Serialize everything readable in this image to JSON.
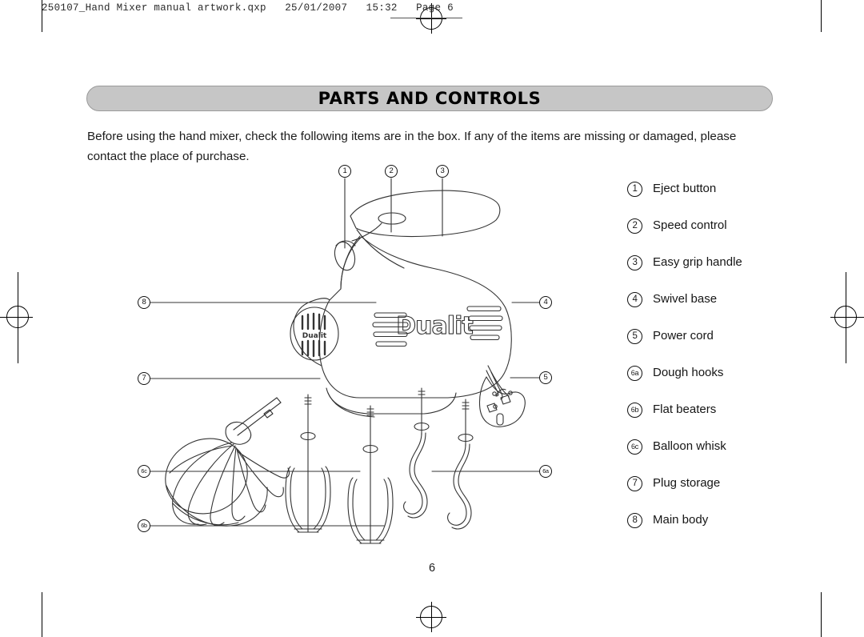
{
  "file_header": {
    "text": "250107_Hand Mixer manual artwork.qxp   25/01/2007   15:32   Page 6",
    "filename": "250107_Hand Mixer manual artwork.qxp",
    "date": "25/01/2007",
    "time": "15:32",
    "page_marker": "Page 6"
  },
  "banner": {
    "title": "PARTS AND CONTROLS"
  },
  "intro": {
    "line1": "Before using the hand mixer, check the following items are in the box. If any of the items are missing or damaged,",
    "line2": "please contact the place of purchase."
  },
  "legend": {
    "items": [
      {
        "number": "1",
        "label": "Eject button"
      },
      {
        "number": "2",
        "label": "Speed control"
      },
      {
        "number": "3",
        "label": "Easy grip handle"
      },
      {
        "number": "4",
        "label": "Swivel base"
      },
      {
        "number": "5",
        "label": "Power cord"
      },
      {
        "number": "6a",
        "label": "Dough hooks"
      },
      {
        "number": "6b",
        "label": "Flat beaters"
      },
      {
        "number": "6c",
        "label": "Balloon whisk"
      },
      {
        "number": "7",
        "label": "Plug storage"
      },
      {
        "number": "8",
        "label": "Main body"
      }
    ]
  },
  "diagram": {
    "brand_text": "Dualit",
    "callouts": [
      {
        "number": "1",
        "name": "eject-button"
      },
      {
        "number": "2",
        "name": "speed-control"
      },
      {
        "number": "3",
        "name": "easy-grip-handle"
      },
      {
        "number": "4",
        "name": "swivel-base"
      },
      {
        "number": "5",
        "name": "power-cord"
      },
      {
        "number": "6a",
        "name": "dough-hooks"
      },
      {
        "number": "6b",
        "name": "flat-beaters"
      },
      {
        "number": "6c",
        "name": "balloon-whisk"
      },
      {
        "number": "7",
        "name": "plug-storage"
      },
      {
        "number": "8",
        "name": "main-body"
      }
    ]
  },
  "folio": {
    "page_number": "6"
  },
  "colors": {
    "banner_fill": "#c6c6c6",
    "banner_stroke": "#9a9a9a",
    "text": "#1a1a1a",
    "line_art": "#333333"
  }
}
